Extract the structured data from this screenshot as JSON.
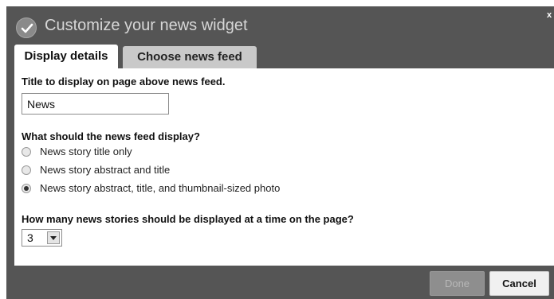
{
  "dialog": {
    "title": "Customize your news widget",
    "close_label": "x"
  },
  "tabs": [
    {
      "label": "Display details",
      "active": true
    },
    {
      "label": "Choose news feed",
      "active": false
    }
  ],
  "form": {
    "title_label": "Title to display on page above news feed.",
    "title_value": "News",
    "display_question": "What should the news feed display?",
    "display_options": [
      {
        "label": "News story title only",
        "checked": false
      },
      {
        "label": "News story abstract and title",
        "checked": false
      },
      {
        "label": "News story abstract, title, and thumbnail-sized photo",
        "checked": true
      }
    ],
    "count_question": "How many news stories should be displayed at a time on the page?",
    "count_value": "3"
  },
  "buttons": {
    "done_label": "Done",
    "cancel_label": "Cancel"
  },
  "icons": {
    "title_icon": "check-circle-icon",
    "select_arrow": "chevron-down-icon"
  },
  "colors": {
    "dialog_background": "#555555",
    "tab_inactive": "#c9c9c9",
    "done_disabled": "#8e8e8e"
  }
}
